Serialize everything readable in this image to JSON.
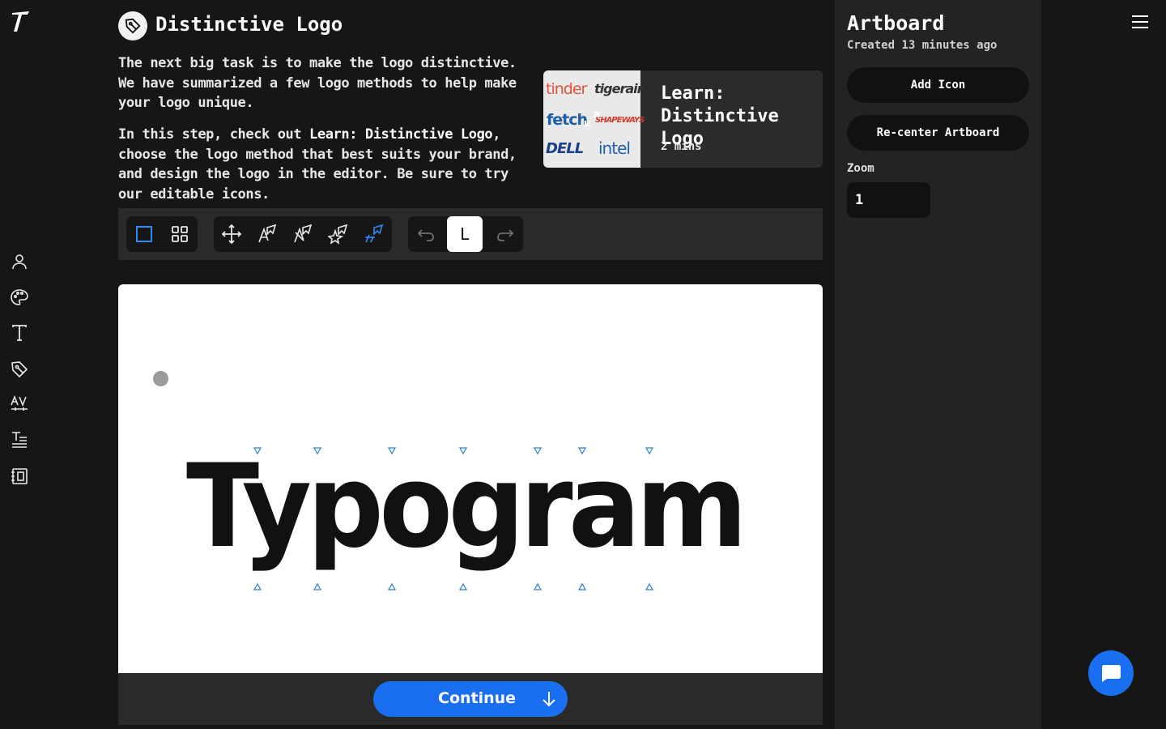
{
  "step": {
    "title": "Distinctive Logo",
    "description_1": "The next big task is to make the logo distinctive. We have summarized a few logo methods to help make your logo unique.",
    "description_2_prefix": "In this step, check out ",
    "description_2_link": "Learn: Distinctive Logo",
    "description_2_suffix": ", choose the logo method that best suits your brand, and design the logo in the editor. Be sure to try our editable icons."
  },
  "learn_card": {
    "title": "Learn: Distinctive Logo",
    "duration": "2 mins",
    "thumb_brands": [
      "tinder",
      "tigerair",
      "fetch",
      "SHAPEWAYS",
      "DELL",
      "intel"
    ]
  },
  "toolbar": {
    "groups": [
      [
        "frame-select-icon",
        "grid-view-icon"
      ],
      [
        "move-icon",
        "anchor-select-icon",
        "anchor-remove-icon",
        "anchor-star-icon",
        "anchor-split-icon"
      ],
      [
        "undo-icon",
        "layer-l-button",
        "redo-icon"
      ]
    ],
    "active_key": "L"
  },
  "canvas": {
    "logo_text": "Typogram"
  },
  "continue_label": "Continue",
  "panel": {
    "title": "Artboard",
    "subtitle": "Created 13 minutes ago",
    "add_icon_label": "Add Icon",
    "recenter_label": "Re-center Artboard",
    "zoom_label": "Zoom",
    "zoom_value": "1"
  },
  "colors": {
    "accent": "#1a6ff0",
    "background": "#161616",
    "panel": "#232323",
    "toolbar": "#2a2a2a",
    "marker": "#2a7fd0"
  }
}
